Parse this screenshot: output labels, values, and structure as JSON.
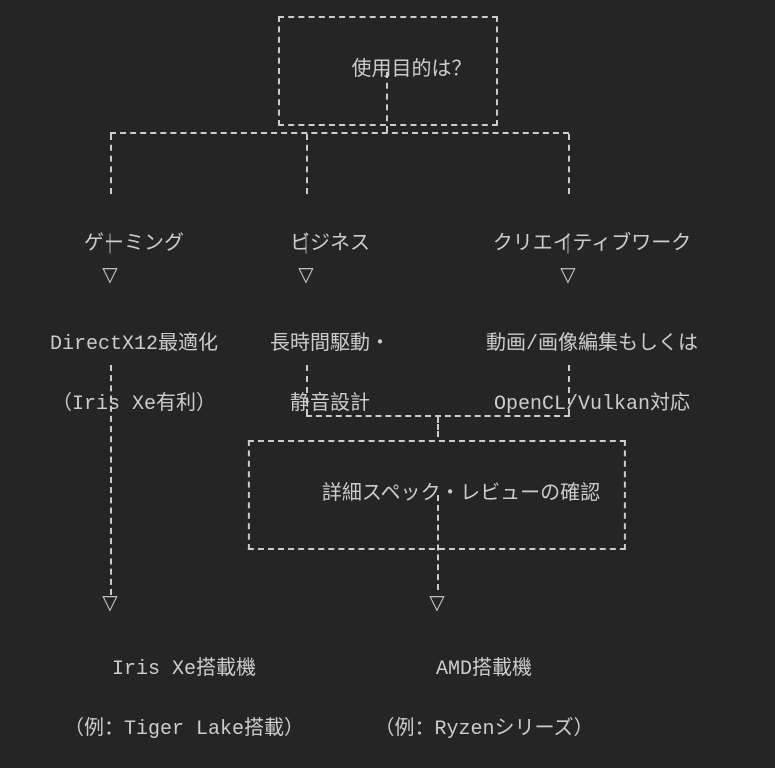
{
  "root": {
    "label": "使用目的は？"
  },
  "branches": {
    "gaming": {
      "label": "ゲーミング",
      "detail_l1": "DirectX12最適化",
      "detail_l2": "（Iris Xe有利）"
    },
    "business": {
      "label": "ビジネス",
      "detail_l1": "長時間駆動・",
      "detail_l2": "静音設計"
    },
    "creative": {
      "label": "クリエイティブワーク",
      "detail_l1": "動画/画像編集もしくは",
      "detail_l2": "OpenCL/Vulkan対応"
    }
  },
  "review": {
    "label": "詳細スペック・レビューの確認"
  },
  "results": {
    "iris": {
      "l1": "Iris Xe搭載機",
      "l2": "（例：Tiger Lake搭載）"
    },
    "amd": {
      "l1": "AMD搭載機",
      "l2": "（例：Ryzenシリーズ）"
    }
  }
}
